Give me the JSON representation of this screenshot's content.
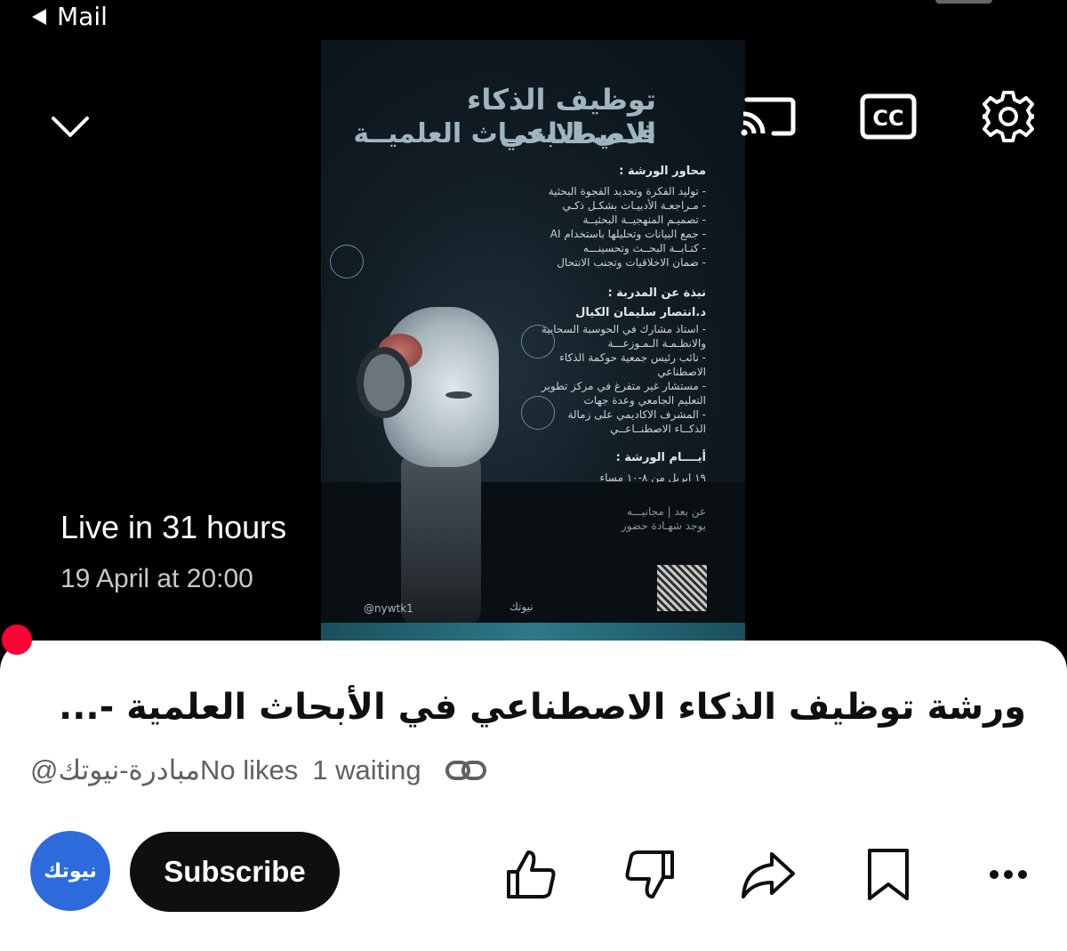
{
  "status_bar": {
    "back_label": "Mail"
  },
  "player": {
    "live_status": "Live in 31 hours",
    "scheduled_time": "19 April at 20:00",
    "icons": [
      "chevron-down-icon",
      "cast-icon",
      "closed-captions-icon",
      "settings-icon"
    ],
    "captions_label": "CC",
    "progress_color": "#ff0033"
  },
  "poster": {
    "title_line1": "توظيف الذكاء الاصطناعي",
    "title_line2": "فــي الابحــاث العلميــة",
    "topics_heading": "محاور الورشة :",
    "topics": [
      "- توليد الفكرة وتحديد الفجوة البحثية",
      "- مـراجعـة الأدبيـات بشكـل ذكـي",
      "- تصميـم المنهجيــة البحثيــة",
      "- جمع البيانات وتحليلها باستخدام AI",
      "- كتـابــة البحــث وتحسينـــه",
      "- ضمان الاخلاقيات  وتجنب الانتحال"
    ],
    "trainer_heading": "نبذة عن المدربة :",
    "trainer_name": "د.انتصار سليمان الكيال",
    "trainer_bio": [
      "- استاذ مشارك في الحوسبة السحابية",
      "والانظـمـة الـمـوزعـــة",
      "- نائب رئيس جمعية حوكمة الذكاء",
      "الاصطناعي",
      "- مستشار غير متفرغ في مركز تطوير",
      "التعليم الجامعي وعدة جهات",
      "- المشرف الاكاديمي على زمالة",
      "الذكــاء الاصطنــاعــي"
    ],
    "days_heading": "أيــــام الورشة :",
    "days_value": "١٩ ابريل من ٨-١٠ مساء",
    "notes": [
      "عن بعد | مجانيـــه",
      "يوجد شهـادة حضور"
    ],
    "handle": "@nywtk1",
    "brand": "نيوتك"
  },
  "video": {
    "title": "ورشة توظيف الذكاء الاصطناعي في الأبحاث العلمية -...",
    "channel_handle": "@مبادرة-نيوتك",
    "likes_text": "No likes",
    "waiting_text": "1 waiting",
    "link_icon": "link-icon"
  },
  "actions": {
    "channel_avatar_text": "نيوتك",
    "subscribe_label": "Subscribe",
    "icons": [
      "like-icon",
      "dislike-icon",
      "share-icon",
      "save-icon",
      "more-icon"
    ]
  }
}
